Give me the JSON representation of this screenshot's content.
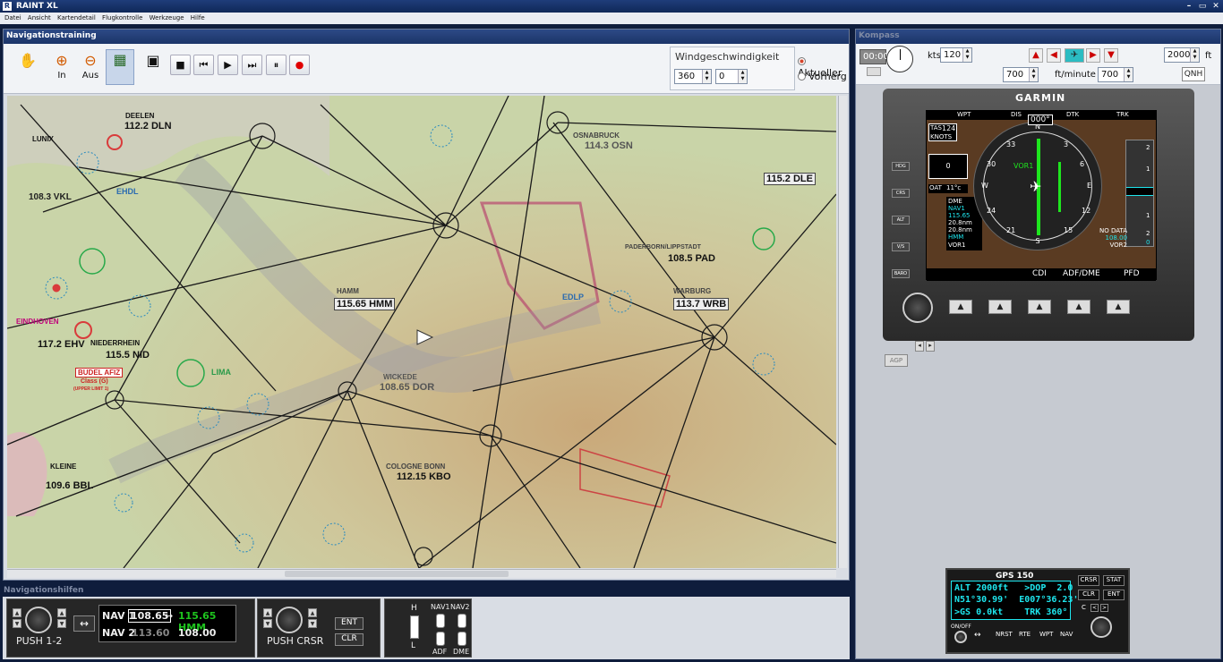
{
  "app": {
    "title": "RAINT XL",
    "menu": [
      "Datei",
      "Ansicht",
      "Kartendetail",
      "Flugkontrolle",
      "Werkzeuge",
      "Hilfe"
    ],
    "win_min": "–",
    "win_restore": "▭",
    "win_close": "✕"
  },
  "nav": {
    "title": "Navigationstraining",
    "tools": {
      "zoom_in": "In",
      "zoom_out": "Aus"
    },
    "wind": {
      "label": "Windgeschwindigkeit",
      "direction": "360",
      "speed": "0",
      "opt_current": "Aktueller",
      "opt_forecast": "Vorherges"
    }
  },
  "map": {
    "vor_labels": [
      {
        "id": "dln",
        "text": "112.2 DLN"
      },
      {
        "id": "osn",
        "text": "114.3 OSN"
      },
      {
        "id": "dle",
        "text": "115.2 DLE"
      },
      {
        "id": "vkl",
        "text": "108.3 VKL"
      },
      {
        "id": "hmm",
        "text": "115.65 HMM"
      },
      {
        "id": "pad",
        "text": "108.5 PAD"
      },
      {
        "id": "wrb",
        "text": "113.7 WRB"
      },
      {
        "id": "ehv",
        "text": "117.2 EHV"
      },
      {
        "id": "nid",
        "text": "115.5 NID"
      },
      {
        "id": "dor",
        "text": "108.65 DOR"
      },
      {
        "id": "kbo",
        "text": "112.15 KBO"
      },
      {
        "id": "bbl",
        "text": "109.6 BBL"
      }
    ],
    "place_labels": [
      {
        "id": "deelen",
        "text": "DEELEN"
      },
      {
        "id": "lunix",
        "text": "LUNIX"
      },
      {
        "id": "osnabruck",
        "text": "OSNABRUCK"
      },
      {
        "id": "hamm",
        "text": "HAMM"
      },
      {
        "id": "eindhoven",
        "text": "EINDHOVEN"
      },
      {
        "id": "niederrhein",
        "text": "NIEDERRHEIN"
      },
      {
        "id": "paderborn",
        "text": "PADERBORN/LIPPSTADT"
      },
      {
        "id": "warburg",
        "text": "WARBURG"
      },
      {
        "id": "wickede",
        "text": "WICKEDE"
      },
      {
        "id": "cologne",
        "text": "COLOGNE BONN"
      },
      {
        "id": "kleine",
        "text": "KLEINE"
      },
      {
        "id": "edlp",
        "text": "EDLP"
      },
      {
        "id": "lima",
        "text": "LIMA"
      },
      {
        "id": "ehdl",
        "text": "EHDL"
      },
      {
        "id": "budel",
        "text": "BUDEL AFIZ"
      },
      {
        "id": "budel_class",
        "text": "Class (G)"
      },
      {
        "id": "budel_limit",
        "text": "(UPPER LIMIT 1)"
      }
    ]
  },
  "aids": {
    "title": "Navigationshilfen",
    "push12": "PUSH 1-2",
    "swap": "↔",
    "nav1_label": "NAV 1",
    "nav1_active": "108.65",
    "nav1_standby": "115.65 HMM",
    "nav2_label": "NAV 2",
    "nav2_active": "113.60",
    "nav2_standby": "108.00",
    "push_crsr": "PUSH CRSR",
    "ent": "ENT",
    "clr": "CLR",
    "h": "H",
    "l": "L",
    "nav1": "NAV1",
    "nav2": "NAV2",
    "adf": "ADF",
    "dme": "DME"
  },
  "compass": {
    "title": "Kompass",
    "clock": "00:00",
    "kts_label": "kts",
    "kts": "120",
    "vs_left": "700",
    "vs_unit": "ft/minute",
    "vs_right": "700",
    "altitude": "2000",
    "alt_unit": "ft",
    "qnh": "QNH",
    "agp": "AGP"
  },
  "garmin": {
    "brand": "GARMIN",
    "top": [
      "WPT",
      "DIS",
      "DTK",
      "TRK"
    ],
    "tas_label": "TAS",
    "tas": "124",
    "knots": "KNOTS",
    "heading": "000°",
    "zero": "0",
    "oat_label": "OAT",
    "oat": "11°c",
    "dme": "DME",
    "nav1": "NAV1",
    "freq": "115.65",
    "dist1": "20.8nm",
    "dist2": "20.8nm",
    "id": "HMM",
    "vor1": "VOR1",
    "vor1_arrow": "VOR1",
    "nodata": "NO DATA",
    "freq2": "108.00",
    "vor2": "VOR2",
    "keys": [
      "CDI",
      "ADF/DME",
      "PFD"
    ],
    "side": [
      "HDG",
      "CRS",
      "ALT",
      "V/S",
      "BARO"
    ],
    "compass_marks": [
      "33",
      "3",
      "6",
      "E",
      "12",
      "15",
      "S",
      "21",
      "24",
      "W",
      "30",
      "N"
    ],
    "vsi": [
      "2",
      "1",
      "1",
      "2",
      "0"
    ]
  },
  "gps": {
    "title": "GPS 150",
    "line1": "ALT 2000ft   >DOP  2.0",
    "line2": "N51°30.99'  E007°36.23'",
    "line3": ">GS 0.0kt    TRK 360°",
    "crsr": "CRSR",
    "stat": "STAT",
    "clr": "CLR",
    "ent": "ENT",
    "c": "C",
    "onoff": "ON/OFF",
    "b1": "NRST",
    "b2": "RTE",
    "b3": "WPT",
    "b4": "NAV"
  }
}
